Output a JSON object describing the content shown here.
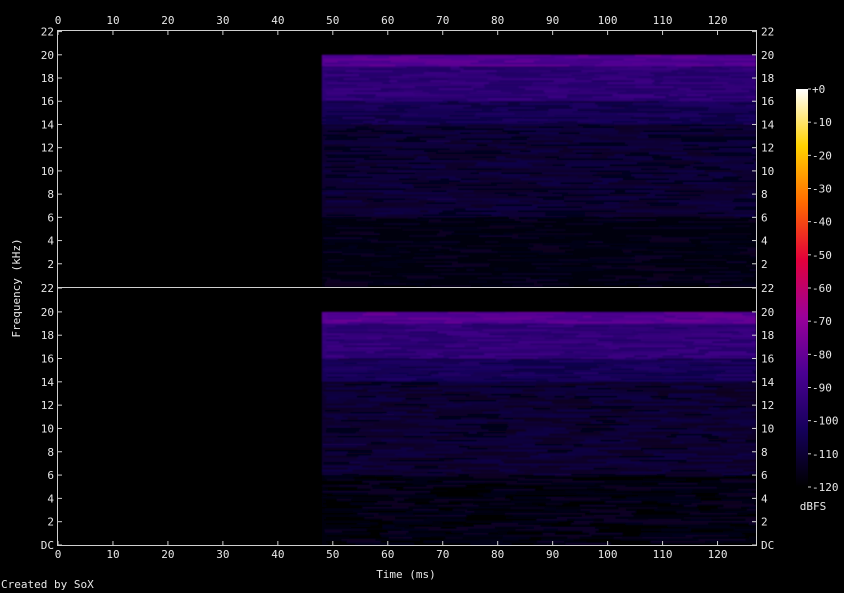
{
  "chart_data": {
    "type": "heatmap",
    "title": "",
    "xlabel": "Time (ms)",
    "ylabel": "Frequency (kHz)",
    "xlim": [
      0,
      127
    ],
    "ylim": [
      0,
      22.05
    ],
    "x_ticks": [
      0,
      10,
      20,
      30,
      40,
      50,
      60,
      70,
      80,
      90,
      100,
      110,
      120
    ],
    "y_ticks": [
      "DC",
      2,
      4,
      6,
      8,
      10,
      12,
      14,
      16,
      18,
      20,
      22
    ],
    "channels": [
      {
        "name": "",
        "signal_start_ms": 48,
        "bands": [
          {
            "khz": [
              19,
              20
            ],
            "dbfs": -84
          },
          {
            "khz": [
              16,
              19
            ],
            "dbfs": -95
          },
          {
            "khz": [
              14,
              16
            ],
            "dbfs": -104
          },
          {
            "khz": [
              6,
              14
            ],
            "dbfs": -111
          },
          {
            "khz": [
              0,
              6
            ],
            "dbfs": -117
          }
        ]
      },
      {
        "name": "",
        "signal_start_ms": 48,
        "bands": [
          {
            "khz": [
              19,
              20
            ],
            "dbfs": -83
          },
          {
            "khz": [
              16,
              19
            ],
            "dbfs": -94
          },
          {
            "khz": [
              14,
              16
            ],
            "dbfs": -103
          },
          {
            "khz": [
              6,
              14
            ],
            "dbfs": -111
          },
          {
            "khz": [
              0,
              6
            ],
            "dbfs": -117
          }
        ]
      }
    ],
    "colorbar": {
      "label": "dBFS",
      "ticks": [
        "+0",
        "-10",
        "-20",
        "-30",
        "-40",
        "-50",
        "-60",
        "-70",
        "-80",
        "-90",
        "-100",
        "-110",
        "-120"
      ],
      "range": [
        -120,
        0
      ],
      "colors": [
        "#000000",
        "#15005a",
        "#4a0092",
        "#9a009a",
        "#e2003a",
        "#ff6a00",
        "#ffd200",
        "#ffffff"
      ]
    }
  },
  "credit": "Created by SoX"
}
